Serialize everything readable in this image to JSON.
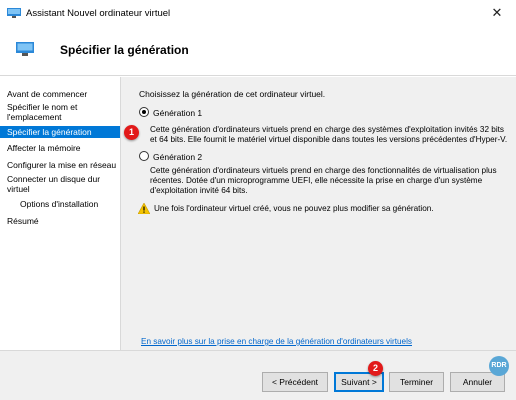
{
  "window": {
    "title": "Assistant Nouvel ordinateur virtuel",
    "close_glyph": "✕",
    "icon": "hyperv-monitor-icon"
  },
  "header": {
    "title": "Spécifier la génération",
    "icon": "hyperv-monitor-icon"
  },
  "sidebar": {
    "items": [
      {
        "label": "Avant de commencer"
      },
      {
        "label": "Spécifier le nom et l'emplacement"
      },
      {
        "label": "Spécifier la génération"
      },
      {
        "label": "Affecter la mémoire"
      },
      {
        "label": "Configurer la mise en réseau"
      },
      {
        "label": "Connecter un disque dur virtuel"
      },
      {
        "label": "Options d'installation"
      },
      {
        "label": "Résumé"
      }
    ],
    "active_index": 2
  },
  "content": {
    "intro": "Choisissez la génération de cet ordinateur virtuel.",
    "options": [
      {
        "label": "Génération 1",
        "selected": true,
        "desc_line1": "Cette génération d'ordinateurs virtuels prend en charge des systèmes d'exploitation invités 32 bits",
        "desc_line2": "et 64 bits. Elle fournit le matériel virtuel disponible dans toutes les versions précédentes d'Hyper-V."
      },
      {
        "label": "Génération 2",
        "selected": false,
        "desc_line1": "Cette génération d'ordinateurs virtuels prend en charge des fonctionnalités de virtualisation plus",
        "desc_line2": "récentes. Dotée d'un microprogramme UEFI, elle nécessite la prise en charge d'un système",
        "desc_line3": "d'exploitation invité 64 bits."
      }
    ],
    "warning": "Une fois l'ordinateur virtuel créé, vous ne pouvez plus modifier sa génération.",
    "help_link": "En savoir plus sur la prise en charge de la génération d'ordinateurs virtuels"
  },
  "footer": {
    "previous": "< Précédent",
    "next": "Suivant >",
    "finish": "Terminer",
    "cancel": "Annuler"
  },
  "annotations": {
    "marker1": "1",
    "marker2": "2",
    "watermark": "RDR"
  },
  "colors": {
    "accent": "#0078d7",
    "marker": "#e21a1a",
    "link": "#0066cc",
    "warning": "#f5c400"
  }
}
